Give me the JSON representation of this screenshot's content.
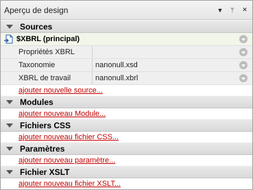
{
  "panel": {
    "title": "Aperçu de design",
    "buttons": {
      "dropdown": "▼",
      "pin": "ᛘ",
      "close": "✕"
    }
  },
  "sources": {
    "header": "Sources",
    "main_item": "$XBRL (principal)",
    "properties": [
      {
        "label": "Propriétés XBRL",
        "value": ""
      },
      {
        "label": "Taxonomie",
        "value": "nanonull.xsd"
      },
      {
        "label": "XBRL de travail",
        "value": "nanonull.xbrl"
      }
    ],
    "add_link": "ajouter nouvelle source..."
  },
  "modules": {
    "header": "Modules",
    "add_link": "ajouter nouveau Module..."
  },
  "css": {
    "header": "Fichiers CSS",
    "add_link": "ajouter nouveau fichier CSS..."
  },
  "params": {
    "header": "Paramètres",
    "add_link": "ajouter nouveau paramètre..."
  },
  "xslt": {
    "header": "Fichier XSLT",
    "add_link": "ajouter nouveau fichier XSLT..."
  }
}
